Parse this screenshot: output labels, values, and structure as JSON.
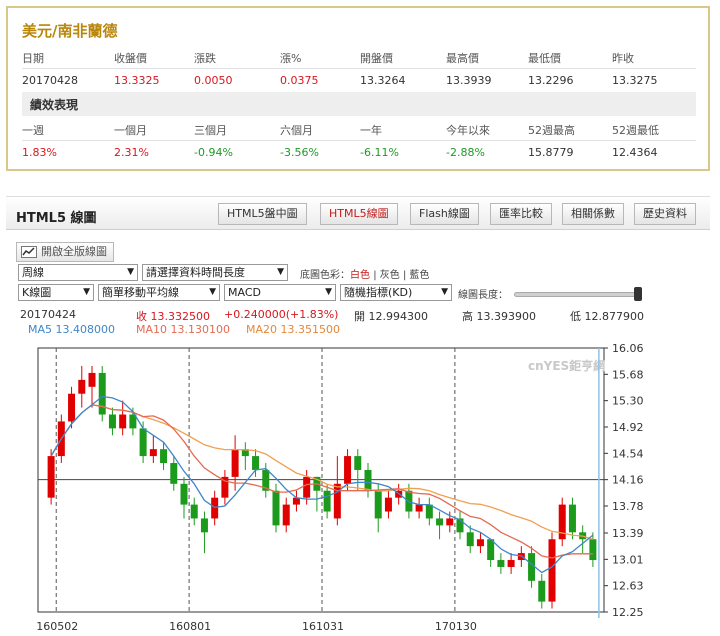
{
  "quote": {
    "title": "美元/南非蘭德",
    "headers": [
      "日期",
      "收盤價",
      "漲跌",
      "漲%",
      "開盤價",
      "最高價",
      "最低價",
      "昨收"
    ],
    "values": [
      "20170428",
      "13.3325",
      "0.0050",
      "0.0375",
      "13.3264",
      "13.3939",
      "13.2296",
      "13.3275"
    ],
    "perf_title": "績效表現",
    "perf_headers": [
      "一週",
      "一個月",
      "三個月",
      "六個月",
      "一年",
      "今年以來",
      "52週最高",
      "52週最低"
    ],
    "perf_values": [
      "1.83%",
      "2.31%",
      "-0.94%",
      "-3.56%",
      "-6.11%",
      "-2.88%",
      "15.8779",
      "12.4364"
    ]
  },
  "chart_panel": {
    "title": "HTML5 線圖",
    "tabs": [
      "HTML5盤中圖",
      "HTML5線圖",
      "Flash線圖",
      "匯率比較",
      "相關係數",
      "歷史資料"
    ],
    "fullscreen": "開啟全版線圖",
    "period": "周線",
    "range": "請選擇資料時間長度",
    "bg_label": "底圖色彩：",
    "bg_white": "白色",
    "bg_gray": "灰色",
    "bg_blue": "藍色",
    "sep": "|",
    "chart_type": "K線圖",
    "ma_type": "簡單移動平均線",
    "indicator1": "MACD",
    "indicator2": "隨機指標(KD)",
    "length_label": "線圖長度："
  },
  "info": {
    "date": "20170424",
    "close": "收 13.332500",
    "change": "+0.240000(+1.83%)",
    "open": "開 12.994300",
    "high": "高 13.393900",
    "low": "低 12.877900",
    "ma5": "MA5 13.408000",
    "ma10": "MA10 13.130100",
    "ma20": "MA20 13.351500"
  },
  "colors": {
    "up": "#e00000",
    "down": "#1c9a1c",
    "ma5": "#3f86c9",
    "ma10": "#e66a52",
    "ma20": "#f0a050"
  },
  "chart_data": {
    "type": "candlestick",
    "watermark": "cnYES鉅亨網",
    "yticks": [
      "16.06",
      "15.68",
      "15.30",
      "14.92",
      "14.54",
      "14.16",
      "13.78",
      "13.39",
      "13.01",
      "12.63",
      "12.25"
    ],
    "xticks": [
      "160502",
      "160801",
      "161031",
      "170130"
    ],
    "ylim": [
      12.25,
      16.06
    ],
    "reference_level": 14.16,
    "candles": [
      [
        13.9,
        14.5,
        13.8,
        14.6
      ],
      [
        14.5,
        15.0,
        14.4,
        15.1
      ],
      [
        15.0,
        15.4,
        14.9,
        15.5
      ],
      [
        15.4,
        15.6,
        15.2,
        15.8
      ],
      [
        15.5,
        15.7,
        15.2,
        15.8
      ],
      [
        15.7,
        15.1,
        15.0,
        15.8
      ],
      [
        15.1,
        14.9,
        14.8,
        15.2
      ],
      [
        14.9,
        15.1,
        14.8,
        15.3
      ],
      [
        15.1,
        14.9,
        14.8,
        15.2
      ],
      [
        14.9,
        14.5,
        14.4,
        15.0
      ],
      [
        14.5,
        14.6,
        14.4,
        14.8
      ],
      [
        14.6,
        14.4,
        14.3,
        14.7
      ],
      [
        14.4,
        14.1,
        14.0,
        14.5
      ],
      [
        14.1,
        13.8,
        13.6,
        14.2
      ],
      [
        13.8,
        13.6,
        13.5,
        13.9
      ],
      [
        13.6,
        13.4,
        13.1,
        13.7
      ],
      [
        13.6,
        13.9,
        13.5,
        14.0
      ],
      [
        13.9,
        14.2,
        13.8,
        14.3
      ],
      [
        14.2,
        14.6,
        14.0,
        14.8
      ],
      [
        14.6,
        14.5,
        14.3,
        14.7
      ],
      [
        14.5,
        14.3,
        14.2,
        14.6
      ],
      [
        14.3,
        14.0,
        13.9,
        14.4
      ],
      [
        14.0,
        13.5,
        13.4,
        14.1
      ],
      [
        13.5,
        13.8,
        13.4,
        13.9
      ],
      [
        13.8,
        13.9,
        13.7,
        14.0
      ],
      [
        13.9,
        14.2,
        13.8,
        14.3
      ],
      [
        14.2,
        14.0,
        13.7,
        14.2
      ],
      [
        14.0,
        13.7,
        13.6,
        14.1
      ],
      [
        13.6,
        14.1,
        13.5,
        14.5
      ],
      [
        14.1,
        14.5,
        14.0,
        14.6
      ],
      [
        14.5,
        14.3,
        14.0,
        14.6
      ],
      [
        14.3,
        14.0,
        13.9,
        14.4
      ],
      [
        14.0,
        13.6,
        13.4,
        14.1
      ],
      [
        13.7,
        13.9,
        13.6,
        14.0
      ],
      [
        13.9,
        14.0,
        13.8,
        14.1
      ],
      [
        14.0,
        13.7,
        13.6,
        14.1
      ],
      [
        13.7,
        13.8,
        13.6,
        13.9
      ],
      [
        13.8,
        13.6,
        13.5,
        13.9
      ],
      [
        13.6,
        13.5,
        13.3,
        13.7
      ],
      [
        13.5,
        13.6,
        13.4,
        13.7
      ],
      [
        13.6,
        13.4,
        13.3,
        13.7
      ],
      [
        13.4,
        13.2,
        13.1,
        13.5
      ],
      [
        13.2,
        13.3,
        13.1,
        13.4
      ],
      [
        13.3,
        13.0,
        12.9,
        13.3
      ],
      [
        13.0,
        12.9,
        12.8,
        13.1
      ],
      [
        12.9,
        13.0,
        12.8,
        13.1
      ],
      [
        13.0,
        13.1,
        12.9,
        13.2
      ],
      [
        13.1,
        12.7,
        12.6,
        13.2
      ],
      [
        12.7,
        12.4,
        12.3,
        12.8
      ],
      [
        12.4,
        13.3,
        12.3,
        13.4
      ],
      [
        13.3,
        13.8,
        13.2,
        13.9
      ],
      [
        13.8,
        13.4,
        13.3,
        13.9
      ],
      [
        13.4,
        13.3,
        13.1,
        13.5
      ],
      [
        13.3,
        13.0,
        12.9,
        13.4
      ]
    ]
  }
}
